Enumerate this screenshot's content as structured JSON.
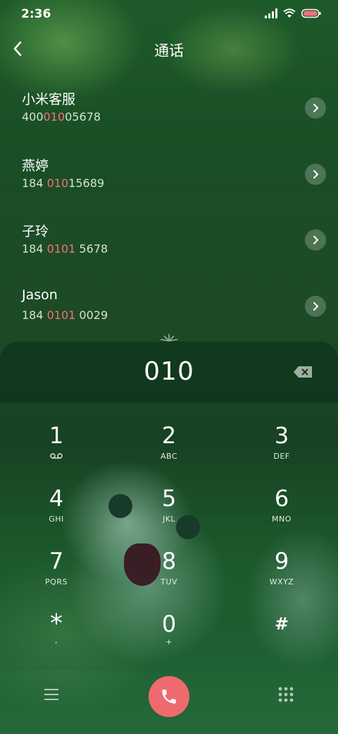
{
  "status": {
    "time": "2:36"
  },
  "header": {
    "title": "通话"
  },
  "contacts": [
    {
      "name": "小米客服",
      "number_pre": "400",
      "number_hl": "010",
      "number_post": "05678"
    },
    {
      "name": "燕婷",
      "number_pre": "184 ",
      "number_hl": "010",
      "number_post": "15689"
    },
    {
      "name": "子玲",
      "number_pre": "184 ",
      "number_hl": "0101",
      "number_post": " 5678"
    },
    {
      "name": "Jason",
      "number_pre": "184 ",
      "number_hl": "0101",
      "number_post": " 0029"
    }
  ],
  "dialer": {
    "digits": "010"
  },
  "keypad": [
    {
      "digit": "1",
      "letters": "⌨"
    },
    {
      "digit": "2",
      "letters": "ABC"
    },
    {
      "digit": "3",
      "letters": "DEF"
    },
    {
      "digit": "4",
      "letters": "GHI"
    },
    {
      "digit": "5",
      "letters": "JKL"
    },
    {
      "digit": "6",
      "letters": "MNO"
    },
    {
      "digit": "7",
      "letters": "PQRS"
    },
    {
      "digit": "8",
      "letters": "TUV"
    },
    {
      "digit": "9",
      "letters": "WXYZ"
    },
    {
      "digit": "*",
      "letters": ","
    },
    {
      "digit": "0",
      "letters": "+"
    },
    {
      "digit": "#",
      "letters": ""
    }
  ],
  "colors": {
    "highlight": "#f2727a",
    "call": "#ef6a6e",
    "panel": "#0f371e"
  }
}
